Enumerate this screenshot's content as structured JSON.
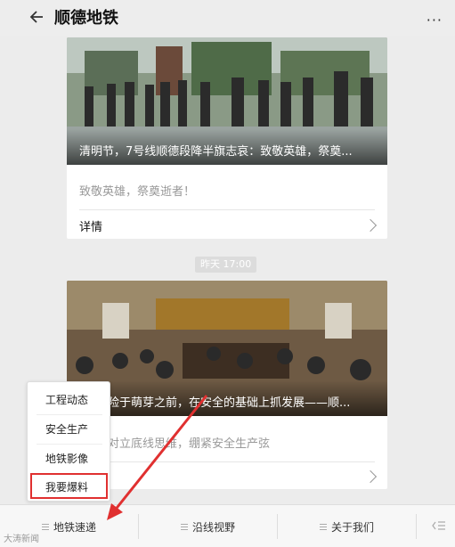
{
  "header": {
    "title": "顺德地铁",
    "more": "···"
  },
  "articles": [
    {
      "caption": "清明节，7号线顺德段降半旗志哀：致敬英雄，祭奠...",
      "summary": "致敬英雄，祭奠逝者！",
      "detail_label": "详情"
    },
    {
      "caption": "险于萌芽之前，在安全的基础上抓发展——顺...",
      "summary": "对立底线思维，绷紧安全生产弦"
    }
  ],
  "timestamp": "昨天 17:00",
  "popup_menu": {
    "items": [
      "工程动态",
      "安全生产",
      "地铁影像",
      "我要爆料"
    ],
    "highlighted": "我要爆料"
  },
  "bottom_tabs": [
    {
      "label": "地铁速递"
    },
    {
      "label": "沿线视野"
    },
    {
      "label": "关于我们"
    }
  ],
  "watermark": "大涛新闻",
  "colors": {
    "highlight": "#e03030",
    "accent_arrow": "#e03030"
  }
}
